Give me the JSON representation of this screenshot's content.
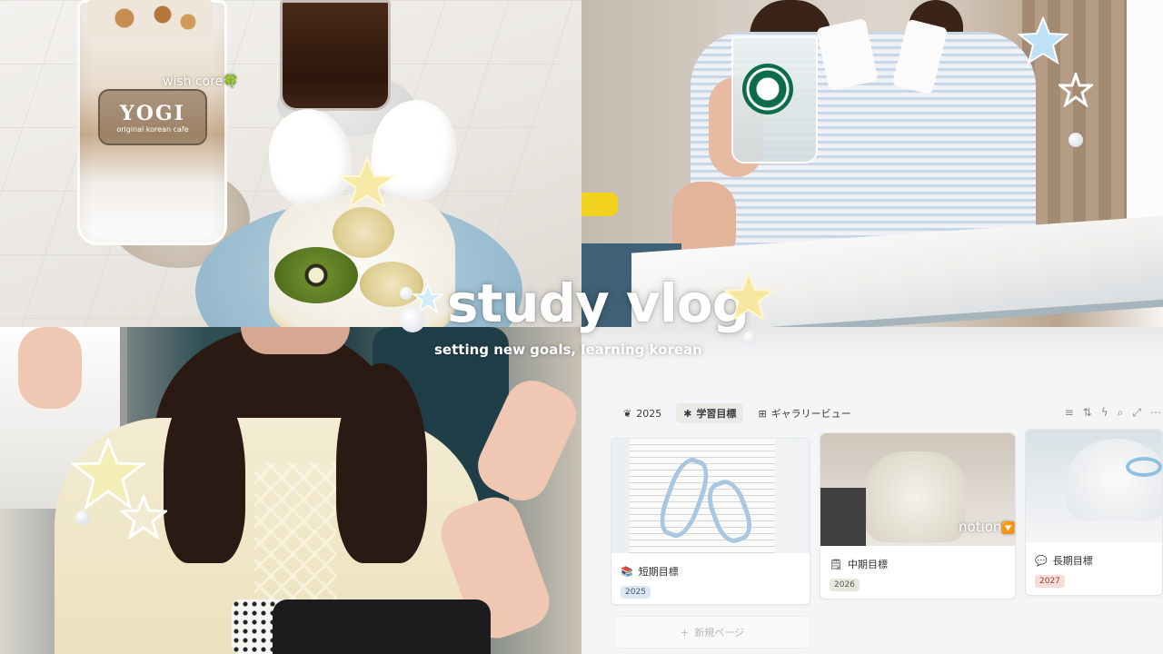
{
  "overlay": {
    "title": "study vlog",
    "subtitle": "setting new goals, learning korean",
    "caption_cafe": "wish core",
    "caption_cafe_emoji": "🍀",
    "caption_notion": "notion",
    "caption_notion_emoji": "🔽"
  },
  "cafe": {
    "cup_brand": "YOGI",
    "cup_tagline": "original korean cafe"
  },
  "notion": {
    "page_label": "2025",
    "tabs": [
      {
        "label": "学習目標",
        "icon": "asterisk-icon",
        "active": true
      },
      {
        "label": "ギャラリービュー",
        "icon": "gallery-grid-icon",
        "active": false
      }
    ],
    "toolbar_icons": [
      "filter-icon",
      "sort-icon",
      "bolt-icon",
      "search-icon",
      "expand-icon",
      "more-icon"
    ],
    "cards": [
      {
        "title": "短期目標",
        "icon": "books-icon",
        "tag": "2025",
        "tag_color": "#dbe8f3"
      },
      {
        "title": "中期目標",
        "icon": "notepad-icon",
        "tag": "2026",
        "tag_color": "#e7e6df"
      },
      {
        "title": "長期目標",
        "icon": "speech-bubble-icon",
        "tag": "2027",
        "tag_color": "#f7dcd8"
      }
    ],
    "new_page_label": "新規ページ"
  },
  "colors": {
    "title_text": "#ffffff",
    "plate_blue": "#9bbdd1",
    "seat_teal": "#1f3e47",
    "starbucks_green": "#0c6b49"
  }
}
